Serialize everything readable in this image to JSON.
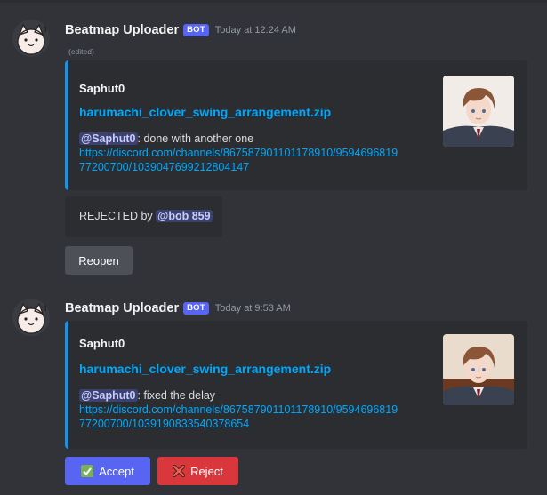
{
  "messages": [
    {
      "username": "Beatmap Uploader",
      "badge": "BOT",
      "timestamp": "Today at 12:24 AM",
      "edited": "(edited)",
      "embed": {
        "author": "Saphut0",
        "title": "harumachi_clover_swing_arrangement.zip",
        "mention": "@Saphut0",
        "text": ": done with another one",
        "link_line1": "https://discord.com/channels/867587901101178910/9594696819",
        "link_line2": "77200700/1039047699212804147"
      },
      "rejected_text": "REJECTED by",
      "rejected_mention": "@bob 859",
      "button": "Reopen"
    },
    {
      "username": "Beatmap Uploader",
      "badge": "BOT",
      "timestamp": "Today at 9:53 AM",
      "embed": {
        "author": "Saphut0",
        "title": "harumachi_clover_swing_arrangement.zip",
        "mention": "@Saphut0",
        "text": ": fixed the delay",
        "link_line1": "https://discord.com/channels/867587901101178910/9594696819",
        "link_line2": "77200700/1039190833540378654"
      },
      "accept_label": "Accept",
      "reject_label": "Reject"
    }
  ],
  "icons": {
    "avatar": "cat-avatar-icon",
    "thumbnail": "anime-boy-thumbnail",
    "accept": "check-mark-icon",
    "reject": "cross-mark-icon"
  },
  "colors": {
    "background": "#313338",
    "embed_bg": "#2b2d31",
    "embed_accent": "#1b93e2",
    "link": "#00a8fc",
    "bot_badge": "#5865f2",
    "accept_button": "#5865f2",
    "reject_button": "#da373c",
    "reopen_button": "#4e5058"
  }
}
